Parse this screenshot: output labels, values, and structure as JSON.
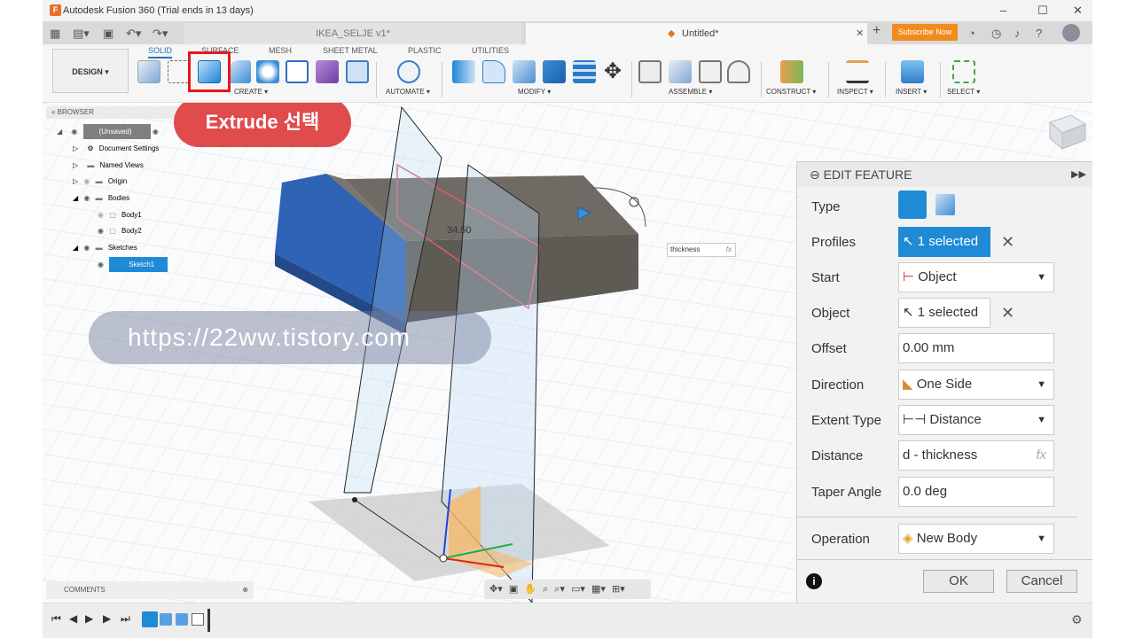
{
  "window": {
    "title": "Autodesk Fusion 360 (Trial ends in 13 days)",
    "controls": [
      "–",
      "☐",
      "✕"
    ]
  },
  "tabs": {
    "inactive": "IKEA_SELJE v1*",
    "active": "Untitled*",
    "subscribe": "Subscribe Now"
  },
  "toolbar": {
    "design": "DESIGN ▾",
    "workspace_tabs": [
      "SOLID",
      "SURFACE",
      "MESH",
      "SHEET METAL",
      "PLASTIC",
      "UTILITIES"
    ],
    "groups": [
      "CREATE ▾",
      "AUTOMATE ▾",
      "MODIFY ▾",
      "ASSEMBLE ▾",
      "CONSTRUCT ▾",
      "INSPECT ▾",
      "INSERT ▾",
      "SELECT ▾"
    ]
  },
  "browser": {
    "header": "BROWSER",
    "items": [
      "(Unsaved)",
      "Document Settings",
      "Named Views",
      "Origin",
      "Bodies",
      "Body1",
      "Body2",
      "Sketches",
      "Sketch1"
    ],
    "comments": "COMMENTS"
  },
  "callout": "Extrude 선택",
  "watermark": "https://22ww.tistory.com",
  "viewport": {
    "dimension": "34.50",
    "thickness_label": "thickness",
    "fx": "fx"
  },
  "edit_feature": {
    "header": "EDIT FEATURE",
    "labels": [
      "Type",
      "Profiles",
      "Start",
      "Object",
      "Offset",
      "Direction",
      "Extent Type",
      "Distance",
      "Taper Angle",
      "Operation"
    ],
    "profiles_value": "1 selected",
    "start_value": "Object",
    "object_value": "1 selected",
    "offset_value": "0.00 mm",
    "direction_value": "One Side",
    "extent_value": "Distance",
    "distance_value": "d - thickness",
    "taper_value": "0.0 deg",
    "operation_value": "New Body",
    "ok": "OK",
    "cancel": "Cancel"
  }
}
